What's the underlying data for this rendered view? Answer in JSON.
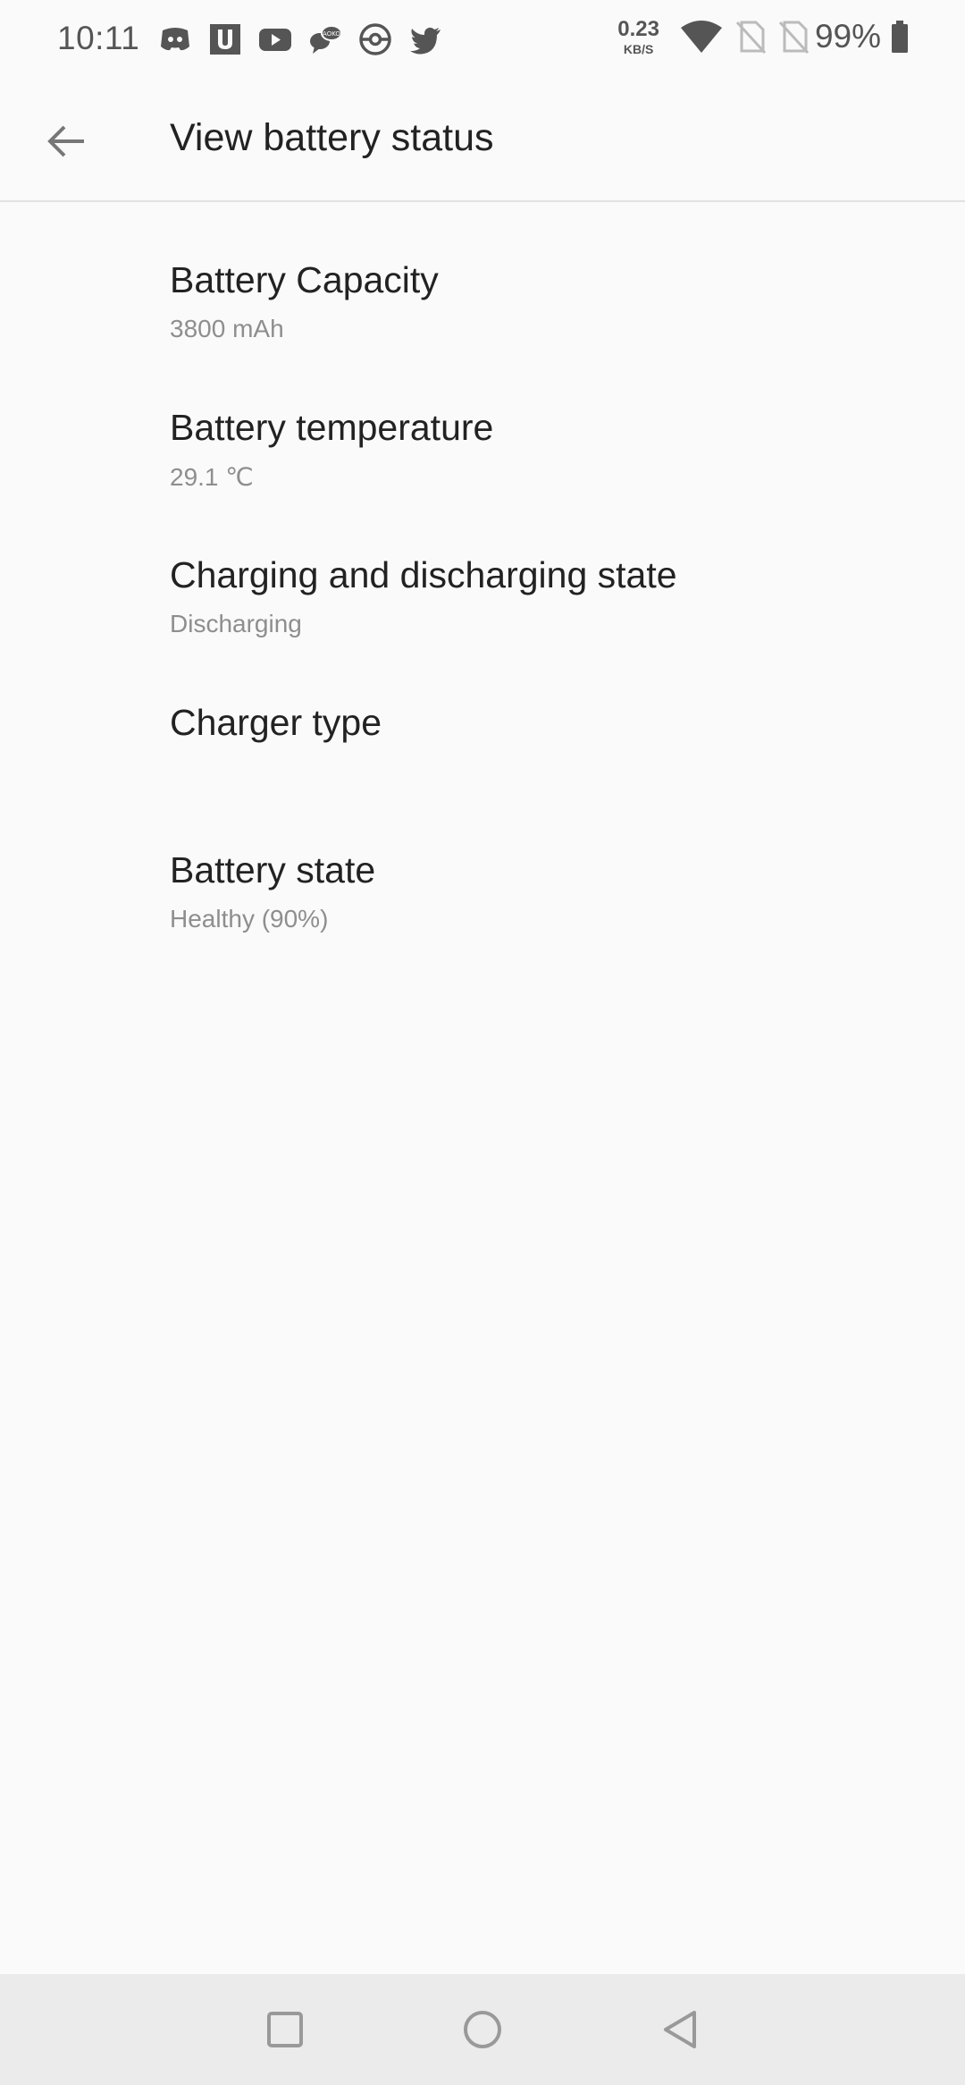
{
  "status_bar": {
    "time": "10:11",
    "notification_icons": [
      "discord-icon",
      "u-app-icon",
      "youtube-icon",
      "chat-app-icon",
      "pokeball-icon",
      "twitter-icon"
    ],
    "net_speed_value": "0.23",
    "net_speed_unit": "KB/S",
    "battery_percent": "99%",
    "wifi_icon": "wifi-icon",
    "sim_icons": [
      "no-sim-icon",
      "no-sim-icon"
    ],
    "battery_icon": "battery-icon"
  },
  "app_bar": {
    "back_icon": "arrow-back-icon",
    "title": "View battery status"
  },
  "items": [
    {
      "title": "Battery Capacity",
      "subtitle": "3800 mAh"
    },
    {
      "title": "Battery temperature",
      "subtitle": "29.1 ℃"
    },
    {
      "title": "Charging and discharging state",
      "subtitle": "Discharging"
    },
    {
      "title": "Charger type",
      "subtitle": ""
    },
    {
      "title": "Battery state",
      "subtitle": "Healthy (90%)"
    }
  ],
  "nav_bar": {
    "recents_icon": "square-recents-icon",
    "home_icon": "circle-home-icon",
    "back_icon": "triangle-back-icon"
  },
  "colors": {
    "background": "#fafafa",
    "nav_background": "#ebebeb",
    "text_primary": "#222222",
    "text_secondary": "#8e8e8e",
    "icon_gray": "#555555"
  }
}
